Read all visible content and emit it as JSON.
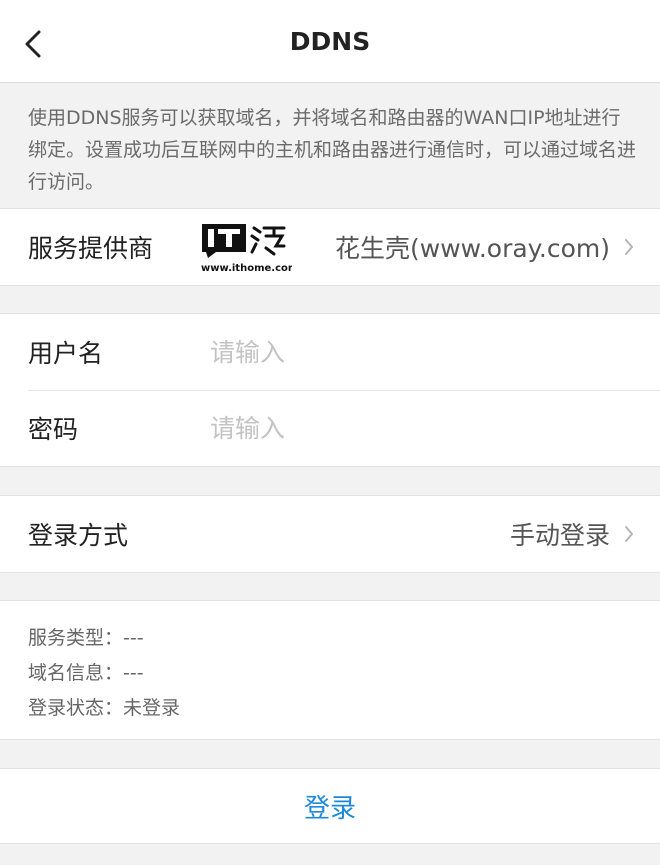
{
  "header": {
    "title": "DDNS",
    "back_icon": "chevron-left-icon"
  },
  "description": "使用DDNS服务可以获取域名，并将域名和路由器的WAN口IP地址进行绑定。设置成功后互联网中的主机和路由器进行通信时，可以通过域名进行访问。",
  "provider": {
    "label": "服务提供商",
    "value": "花生壳(www.oray.com)"
  },
  "watermark": {
    "text": "IT之家",
    "url": "www.ithome.com"
  },
  "account": {
    "username_label": "用户名",
    "username_value": "",
    "username_placeholder": "请输入",
    "password_label": "密码",
    "password_value": "",
    "password_placeholder": "请输入"
  },
  "login_mode": {
    "label": "登录方式",
    "value": "手动登录"
  },
  "status": {
    "service_type": "服务类型：---",
    "domain_info": "域名信息：---",
    "login_status": "登录状态：未登录"
  },
  "login_button": "登录",
  "colors": {
    "accent": "#1e88d9",
    "background": "#f2f2f2",
    "card": "#ffffff"
  }
}
